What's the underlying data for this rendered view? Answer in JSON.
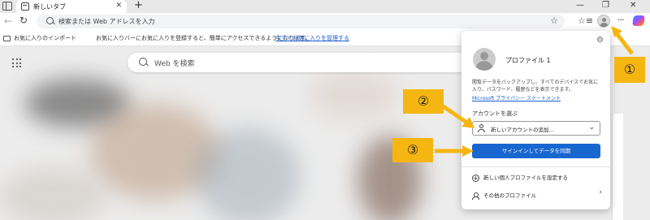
{
  "tab": {
    "title": "新しいタブ",
    "close": "✕"
  },
  "newtab": "+",
  "window": {
    "minimize": "—",
    "restore": "❐",
    "close": "✕"
  },
  "toolbar": {
    "back": "←",
    "refresh": "↻",
    "address_placeholder": "検索または Web アドレスを入力",
    "favorite_star": "☆",
    "favorites": "☆≡",
    "more": "···"
  },
  "favbar": {
    "import": "お気に入りのインポート",
    "message": "お気に入りバーにお気に入りを登録すると、簡単にアクセスできるようになります。",
    "manage_link": "今すぐお気に入りを管理する"
  },
  "web_search": {
    "placeholder": "Web を検索"
  },
  "flyout": {
    "gear": "⚙",
    "profile_name": "プロファイル 1",
    "description": "閲覧データをバックアップし、すべてのデバイスでお気に入り、パスワード、履歴などを表示できます。",
    "privacy_link": "Microsoft プライバシー ステートメント",
    "choose_account": "アカウントを選ぶ",
    "account_select": "新しいアカウントの追加...",
    "account_chevron": "⌄",
    "signin_button": "サインインしてデータを同期",
    "add_profile": "新しい個人プロファイルを設定する",
    "other_profiles": "その他のプロファイル",
    "other_chevron": "›"
  },
  "callouts": {
    "c1": "①",
    "c2": "②",
    "c3": "③"
  },
  "colors": {
    "accent": "#1866d0",
    "callout": "#f6b612",
    "link": "#1a5fd4"
  }
}
